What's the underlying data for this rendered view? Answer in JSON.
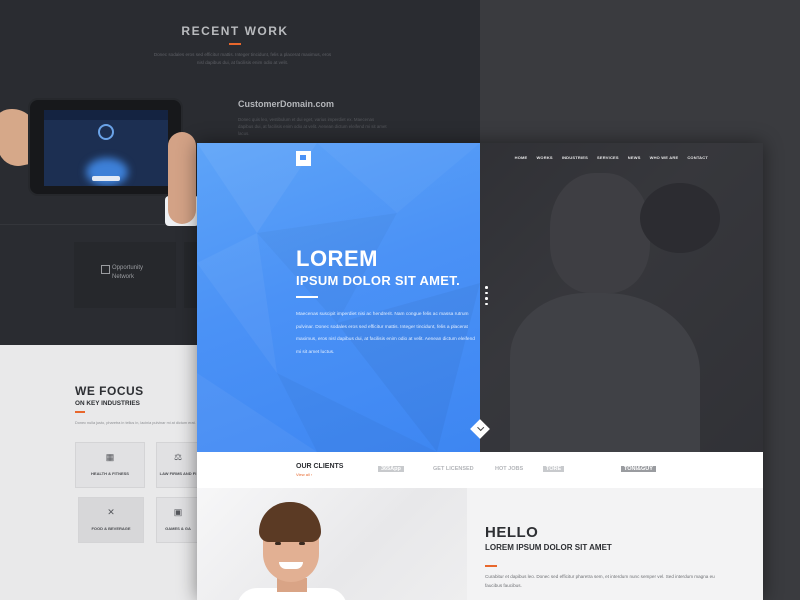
{
  "colors": {
    "accent": "#e8672c",
    "hero_blue": "#4b92f6",
    "dark_bg": "#2a2c31"
  },
  "recent_work": {
    "title": "RECENT WORK",
    "text": "Donec sodales eros sed efficitur mattis. Integer tincidunt, felis a placerat maximus, eros nisl dapibus dui, at facilisis enim odio at velit."
  },
  "customer_domain": {
    "title": "CustomerDomain.com",
    "text": "Donec quis leo, vestibulum et dui eget, varius imperdiet ex. Maecenas dapibus dui, at facilisis enim odio at velit. Aenean dictum eleifend mi sit amet lacus."
  },
  "partner_logo": {
    "line1": "Opportunity",
    "line2": "Network"
  },
  "focus": {
    "title": "WE FOCUS",
    "subtitle": "ON KEY INDUSTRIES",
    "text": "Donec nulla justo, pharetra in tellus in, lacinia pulvinar mi at dictum erat.",
    "industries": [
      {
        "label": "HEALTH & FITNESS",
        "icon": "health-icon"
      },
      {
        "label": "LAW FIRMS AND FI",
        "icon": "scales-icon"
      },
      {
        "label": "FOOD & BEVERAGE",
        "icon": "utensils-icon"
      },
      {
        "label": "GAMES & GA",
        "icon": "gamepad-icon"
      }
    ]
  },
  "nav": {
    "items": [
      "HOME",
      "WORKS",
      "INDUSTRIES",
      "SERVICES",
      "NEWS",
      "WHO WE ARE",
      "CONTACT"
    ]
  },
  "hero": {
    "heading": "LOREM",
    "subheading": "IPSUM DOLOR SIT AMET.",
    "text": "Maecenas suscipit imperdiet nisi ac hendrerit. Nam congue felis ac massa rutrum pulvinar. Donec sodales eros sed efficitur mattis. Integer tincidunt, felis a placerat maximus, eros nisl dapibus dui, at facilisis enim odio at velit. Aenean dictum eleifend mi sit amet luctus.",
    "slide_count": 4
  },
  "clients": {
    "title": "OUR CLIENTS",
    "link": "View all  ›",
    "logos": [
      "365App",
      "GET LICENSED",
      "HOT JOBS",
      "TORE",
      "",
      "TONI&GUY"
    ]
  },
  "hello": {
    "title": "HELLO",
    "subtitle": "LOREM IPSUM DOLOR SIT AMET",
    "text": "Curabitur et dapibus leo. Donec sed efficitur pharetra sem, et interdum nunc semper vel. Sed interdum magna eu faucibus faucibus."
  }
}
